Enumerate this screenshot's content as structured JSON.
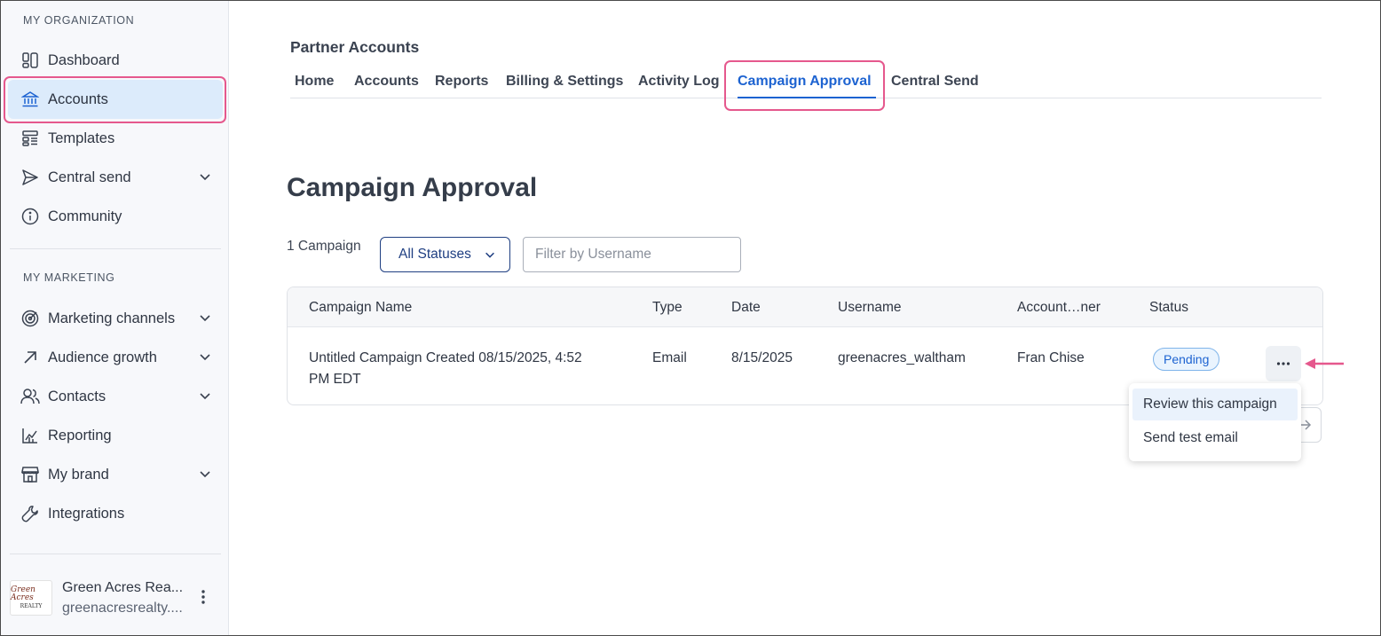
{
  "sidebar": {
    "section_org": "MY ORGANIZATION",
    "org_items": [
      {
        "label": "Dashboard",
        "icon": "dashboard-icon"
      },
      {
        "label": "Accounts",
        "icon": "bank-icon",
        "active": true
      },
      {
        "label": "Templates",
        "icon": "templates-icon"
      },
      {
        "label": "Central send",
        "icon": "send-icon",
        "expandable": true
      },
      {
        "label": "Community",
        "icon": "info-icon"
      }
    ],
    "section_marketing": "MY MARKETING",
    "marketing_items": [
      {
        "label": "Marketing channels",
        "icon": "target-icon",
        "expandable": true
      },
      {
        "label": "Audience growth",
        "icon": "arrow-up-right-icon",
        "expandable": true
      },
      {
        "label": "Contacts",
        "icon": "contacts-icon",
        "expandable": true
      },
      {
        "label": "Reporting",
        "icon": "chart-icon"
      },
      {
        "label": "My brand",
        "icon": "storefront-icon",
        "expandable": true
      },
      {
        "label": "Integrations",
        "icon": "wrench-icon"
      }
    ],
    "org": {
      "name": "Green Acres Rea...",
      "email": "greenacresrealty....",
      "logo_text": "Green Acres",
      "logo_subtext": "REALTY"
    }
  },
  "header": {
    "title": "Partner Accounts",
    "tabs": [
      {
        "label": "Home"
      },
      {
        "label": "Accounts"
      },
      {
        "label": "Reports"
      },
      {
        "label": "Billing & Settings"
      },
      {
        "label": "Activity Log"
      },
      {
        "label": "Campaign Approval",
        "active": true
      },
      {
        "label": "Central Send"
      }
    ]
  },
  "main": {
    "page_title": "Campaign Approval",
    "count_label": "1 Campaign",
    "status_filter": "All Statuses",
    "username_filter_placeholder": "Filter by Username",
    "table": {
      "columns": [
        "Campaign Name",
        "Type",
        "Date",
        "Username",
        "Account…ner",
        "Status"
      ],
      "rows": [
        {
          "name_line1": "Untitled Campaign Created 08/15/2025, 4:52",
          "name_line2": "PM EDT",
          "type": "Email",
          "date": "8/15/2025",
          "username": "greenacres_waltham",
          "account_owner": "Fran Chise",
          "status": "Pending"
        }
      ]
    },
    "row_menu": [
      "Review this campaign",
      "Send test email"
    ]
  },
  "colors": {
    "accent": "#1d63d1",
    "highlight": "#e5588d",
    "active_nav_bg": "#dcebfb",
    "pending_badge_bg": "#eaf4fe"
  }
}
